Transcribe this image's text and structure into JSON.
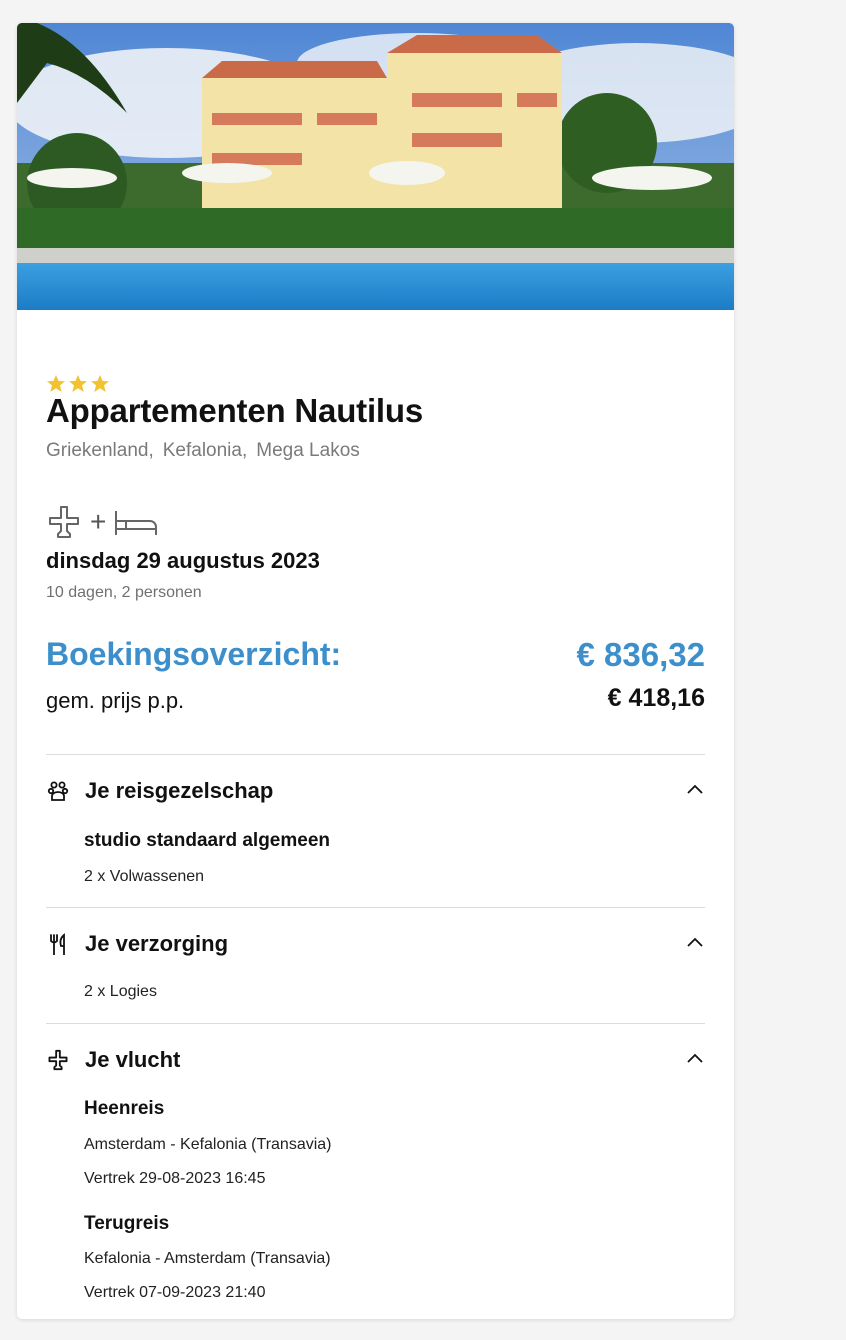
{
  "hotel": {
    "stars": 3,
    "name": "Appartementen Nautilus",
    "location": [
      "Griekenland,",
      "Kefalonia,",
      "Mega Lakos"
    ]
  },
  "trip": {
    "transport_icons": [
      "plane-icon",
      "bed-icon"
    ],
    "plus": "+",
    "date": "dinsdag 29 augustus 2023",
    "duration": "10 dagen, 2 personen"
  },
  "booking": {
    "label": "Boekingsoverzicht:",
    "total": "€ 836,32",
    "pp_label": "gem. prijs p.p.",
    "pp_price": "€ 418,16"
  },
  "sections": {
    "company": {
      "title": "Je reisgezelschap",
      "icon": "group-icon",
      "room": "studio standaard algemeen",
      "persons": "2 x Volwassenen"
    },
    "care": {
      "title": "Je verzorging",
      "icon": "cutlery-icon",
      "board": "2 x Logies"
    },
    "flight": {
      "title": "Je vlucht",
      "icon": "plane-icon",
      "outbound_title": "Heenreis",
      "outbound_route": "Amsterdam - Kefalonia (Transavia)",
      "outbound_departure": "Vertrek 29-08-2023 16:45",
      "return_title": "Terugreis",
      "return_route": "Kefalonia - Amsterdam (Transavia)",
      "return_departure": "Vertrek 07-09-2023 21:40"
    }
  },
  "colors": {
    "accent": "#3c8fcb",
    "star": "#f2c230",
    "muted": "#7a7a7a"
  }
}
